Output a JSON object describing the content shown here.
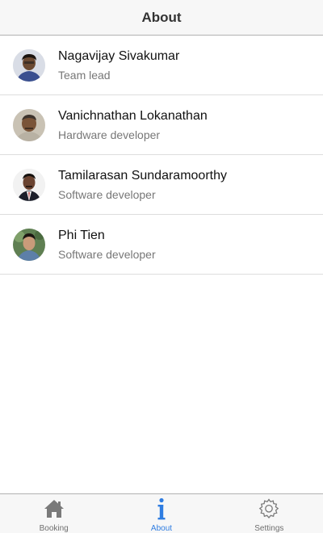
{
  "navbar": {
    "title": "About"
  },
  "team": [
    {
      "name": "Nagavijay Sivakumar",
      "role": "Team lead"
    },
    {
      "name": "Vanichnathan Lokanathan",
      "role": "Hardware developer"
    },
    {
      "name": "Tamilarasan Sundaramoorthy",
      "role": "Software developer"
    },
    {
      "name": "Phi Tien",
      "role": "Software developer"
    }
  ],
  "tabbar": {
    "tabs": [
      {
        "label": "Booking",
        "icon": "home-icon",
        "active": false
      },
      {
        "label": "About",
        "icon": "info-icon",
        "active": true
      },
      {
        "label": "Settings",
        "icon": "gear-icon",
        "active": false
      }
    ],
    "active_color": "#2f7de1",
    "inactive_color": "#6f6f6f"
  }
}
